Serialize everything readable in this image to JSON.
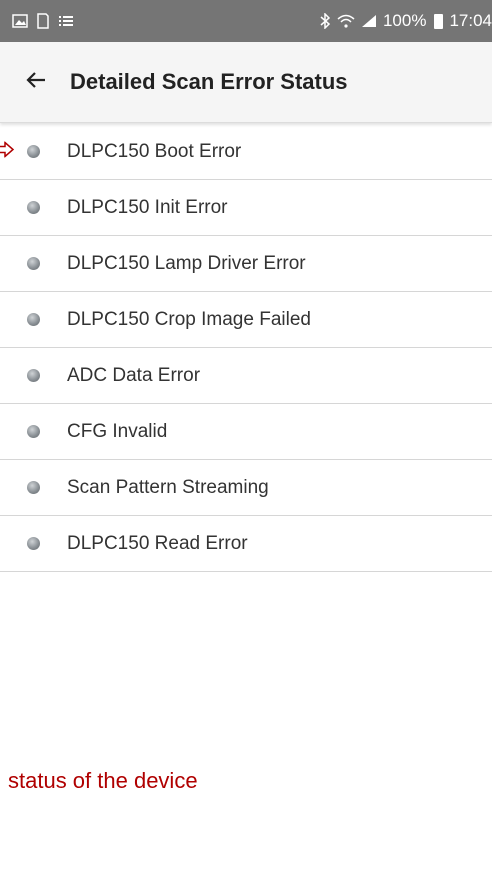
{
  "status_bar": {
    "battery": "100%",
    "time": "17:04",
    "icons_left": [
      "gallery-icon",
      "screen-icon",
      "list-icon"
    ],
    "icons_right": [
      "bluetooth-icon",
      "wifi-icon",
      "signal-icon",
      "battery-icon"
    ]
  },
  "app_bar": {
    "title": "Detailed Scan Error Status",
    "back_icon": "arrow-left-icon"
  },
  "errors": [
    {
      "label": "DLPC150 Boot Error"
    },
    {
      "label": "DLPC150 Init Error"
    },
    {
      "label": "DLPC150 Lamp Driver Error"
    },
    {
      "label": "DLPC150 Crop Image Failed"
    },
    {
      "label": "ADC Data Error"
    },
    {
      "label": "CFG Invalid"
    },
    {
      "label": "Scan Pattern Streaming"
    },
    {
      "label": "DLPC150 Read Error"
    }
  ],
  "annotation": "status of the device",
  "colors": {
    "status_bar": "#757575",
    "app_bar": "#f5f5f5",
    "annotation": "#b00000",
    "indicator": "#8b9196"
  }
}
